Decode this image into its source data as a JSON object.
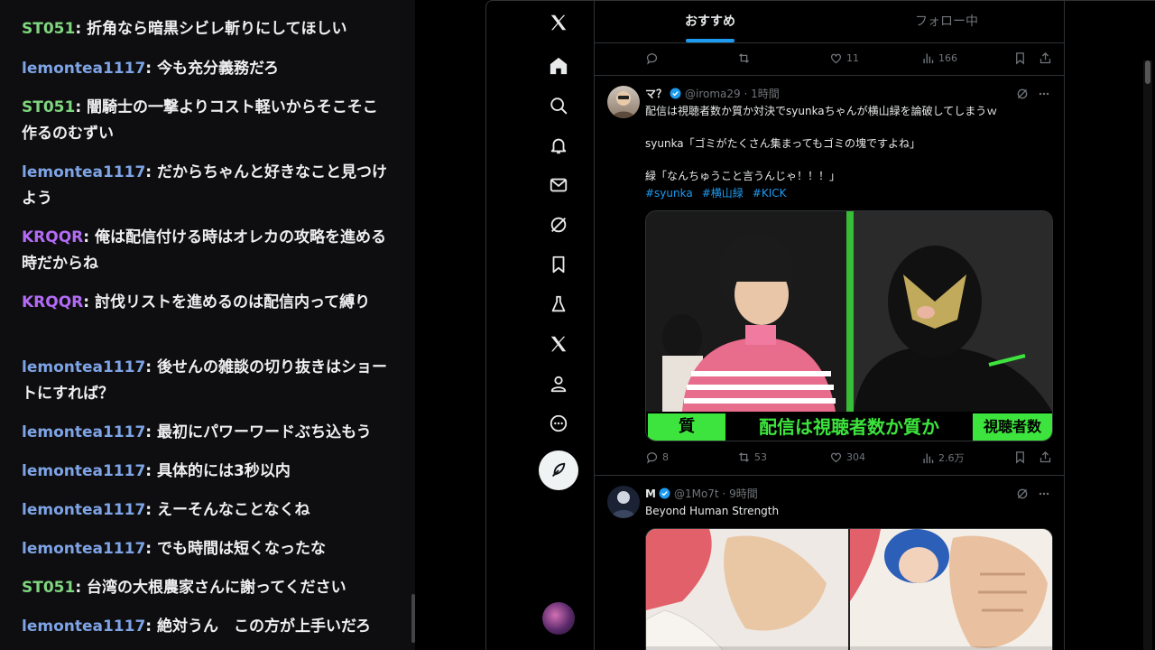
{
  "chat": {
    "messages": [
      {
        "user": "ST051",
        "color": "#7fd67f",
        "text": "折角なら暗黒シビレ斬りにしてほしい"
      },
      {
        "user": "lemontea1117",
        "color": "#7ea4e6",
        "text": "今も充分義務だろ"
      },
      {
        "user": "ST051",
        "color": "#7fd67f",
        "text": "闇騎士の一撃よりコスト軽いからそこそこ作るのむずい"
      },
      {
        "user": "lemontea1117",
        "color": "#7ea4e6",
        "text": "だからちゃんと好きなこと見つけよう"
      },
      {
        "user": "KRQQR",
        "color": "#b36bf5",
        "text": "俺は配信付ける時はオレカの攻略を進める時だからね"
      },
      {
        "user": "KRQQR",
        "color": "#b36bf5",
        "text": "討伐リストを進めるのは配信内って縛り"
      },
      {
        "user": "lemontea1117",
        "color": "#7ea4e6",
        "text": "後せんの雑談の切り抜きはショートにすれば？"
      },
      {
        "user": "lemontea1117",
        "color": "#7ea4e6",
        "text": "最初にパワーワードぶち込もう"
      },
      {
        "user": "lemontea1117",
        "color": "#7ea4e6",
        "text": "具体的には3秒以内"
      },
      {
        "user": "lemontea1117",
        "color": "#7ea4e6",
        "text": "えーそんなことなくね"
      },
      {
        "user": "lemontea1117",
        "color": "#7ea4e6",
        "text": "でも時間は短くなったな"
      },
      {
        "user": "ST051",
        "color": "#7fd67f",
        "text": "台湾の大根農家さんに謝ってください"
      },
      {
        "user": "lemontea1117",
        "color": "#7ea4e6",
        "text": "絶対うん　この方が上手いだろ"
      }
    ]
  },
  "twitter": {
    "nav_icons": [
      "x-logo-icon",
      "home-icon",
      "search-icon",
      "notifications-icon",
      "messages-icon",
      "grok-icon",
      "bookmarks-icon",
      "premium-icon",
      "x-premium-icon",
      "profile-icon",
      "more-icon"
    ],
    "tabs": {
      "recommended": "おすすめ",
      "following": "フォロー中"
    },
    "prev_tweet": {
      "replies": "",
      "retweets": "",
      "likes": "11",
      "views": "166"
    },
    "tweet1": {
      "name": "マ？",
      "handle": "@iroma29 · 1時間",
      "line1": "配信は視聴者数か質か対決でsyunkaちゃんが横山緑を論破してしまうｗ",
      "line2": "syunka「ゴミがたくさん集まってもゴミの塊ですよね」",
      "line3": "緑「なんちゅうこと言うんじゃ！！！」",
      "hashtags": [
        "#syunka",
        "#横山緑",
        "#KICK"
      ],
      "caption": {
        "left": "質",
        "center": "配信は視聴者数か質か",
        "right": "視聴者数"
      },
      "replies": "8",
      "retweets": "53",
      "likes": "304",
      "views": "2.6万"
    },
    "tweet2": {
      "name": "M",
      "handle": "@1Mo7t · 9時間",
      "text": "Beyond Human Strength"
    },
    "colors": {
      "accent": "#1d9bf0",
      "caption_green": "#3de43d",
      "background": "#000000"
    }
  }
}
